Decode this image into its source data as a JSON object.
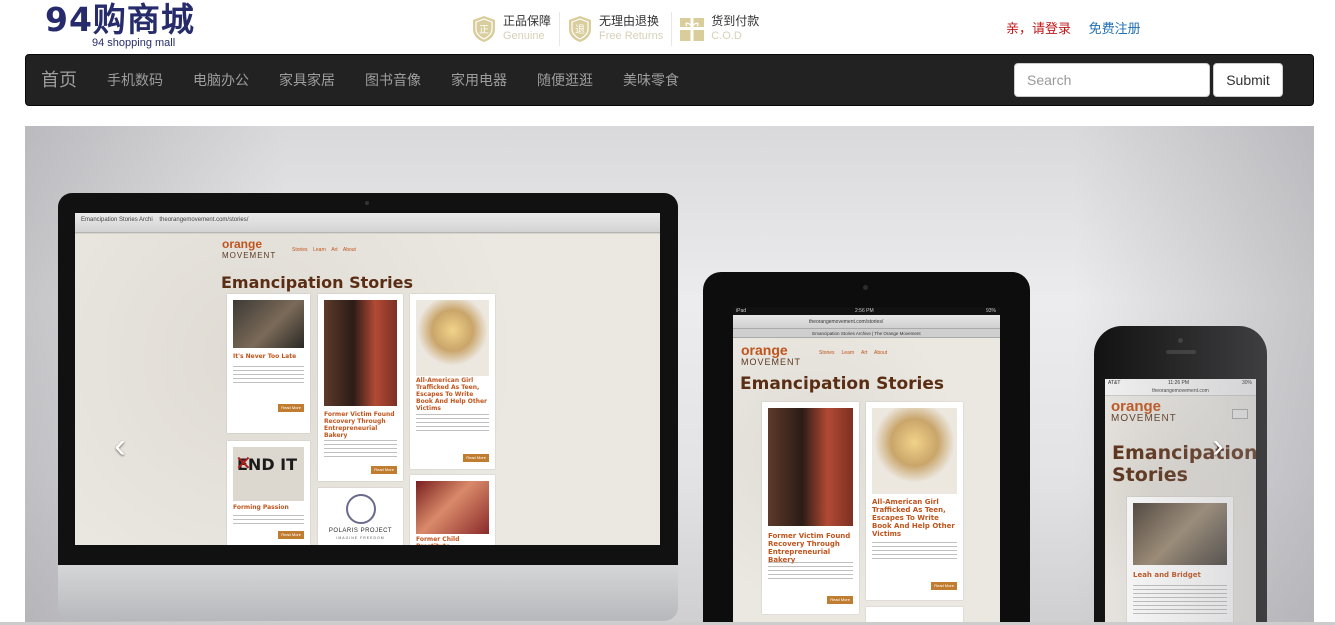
{
  "header": {
    "logo_main": "94购商城",
    "logo_sub": "94 shopping mall",
    "promises": [
      {
        "title": "正品保障",
        "subtitle": "Genuine",
        "icon": "genuine-badge-icon",
        "glyph": "正"
      },
      {
        "title": "无理由退换",
        "subtitle": "Free Returns",
        "icon": "returns-badge-icon",
        "glyph": "退"
      },
      {
        "title": "货到付款",
        "subtitle": "C.O.D",
        "icon": "gift-box-icon",
        "glyph": ""
      }
    ],
    "login_label": "亲，请登录",
    "register_label": "免费注册"
  },
  "nav": {
    "brand": "首页",
    "items": [
      "手机数码",
      "电脑办公",
      "家具家居",
      "图书音像",
      "家用电器",
      "随便逛逛",
      "美味零食"
    ],
    "search_placeholder": "Search",
    "submit_label": "Submit"
  },
  "carousel": {
    "prev_label": "‹",
    "next_label": "›",
    "desktop": {
      "browser_tab": "Emancipation Stories Archi",
      "url": "theorangemovement.com/stories/",
      "logo_main": "orange",
      "logo_sub": "MOVEMENT",
      "menu": [
        "Stories",
        "Learn",
        "Art",
        "About"
      ],
      "title": "Emancipation Stories",
      "cards": [
        {
          "title": "It's Never Too Late",
          "button": "Read More"
        },
        {
          "title": "Former Victim Found Recovery Through Entrepreneurial Bakery",
          "button": "Read More"
        },
        {
          "title": "All-American Girl Trafficked As Teen, Escapes To Write Book And Help Other Victims",
          "button": "Read More"
        },
        {
          "title": "Forming Passion",
          "button": "Read More",
          "image_text": "END IT"
        },
        {
          "title": "Polaris Project",
          "button": "",
          "image_text": "POLARIS PROJECT",
          "image_sub": "IMAGINE FREEDOM"
        },
        {
          "title": "Former Child Prostitute,",
          "button": ""
        }
      ]
    },
    "tablet": {
      "status_left": "iPad",
      "status_time": "2:56 PM",
      "status_right": "93%",
      "url": "theorangemovement.com/stories/",
      "tab_title": "Emancipation Stories Archive | The Orange Movement",
      "logo_main": "orange",
      "logo_sub": "MOVEMENT",
      "menu": [
        "Stories",
        "Learn",
        "Art",
        "About"
      ],
      "title": "Emancipation Stories",
      "cards": [
        {
          "title": "Former Victim Found Recovery Through Entrepreneurial Bakery",
          "button": "Read More"
        },
        {
          "title": "All-American Girl Trafficked As Teen, Escapes To Write Book And Help Other Victims",
          "button": "Read More"
        }
      ]
    },
    "phone": {
      "status_left": "AT&T",
      "status_time": "11:26 PM",
      "status_right": "30%",
      "url": "theorangemovement.com",
      "logo_main": "orange",
      "logo_sub": "MOVEMENT",
      "title_line1": "Emancipation",
      "title_line2": "Stories",
      "card_title": "Leah and Bridget"
    }
  },
  "colors": {
    "logo": "#262c6b",
    "login": "#c2181b",
    "register": "#1f6fb3",
    "navbar": "#222222",
    "nav_text": "#9d9d9d",
    "site_accent": "#c0541d"
  }
}
